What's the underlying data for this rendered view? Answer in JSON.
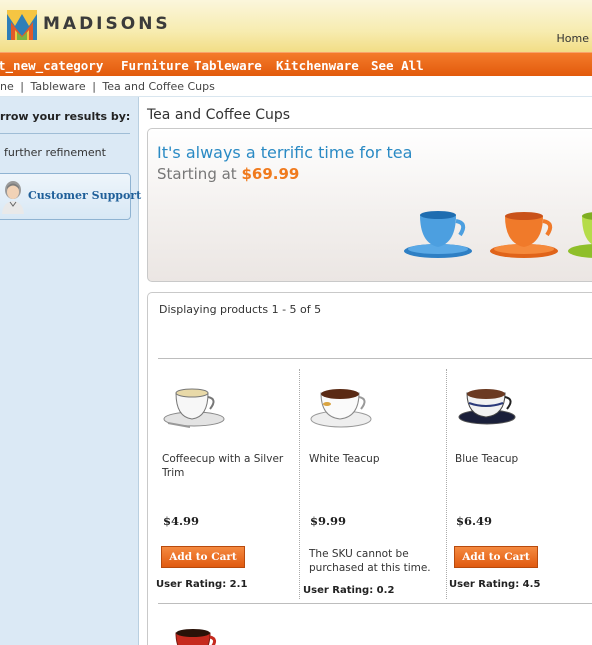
{
  "header": {
    "brand": "MADISONS",
    "home_link": "Home"
  },
  "nav": {
    "items": [
      "t_new_category",
      "Furniture",
      "Tableware",
      "Kitchenware",
      "See All"
    ]
  },
  "breadcrumb": {
    "items": [
      "ne",
      "Tableware",
      "Tea and Coffee Cups"
    ],
    "separator": "|"
  },
  "sidebar": {
    "title": "rrow your results by:",
    "refine_text": "further refinement",
    "support_label": "Customer Support"
  },
  "main": {
    "page_title": "Tea and Coffee Cups",
    "banner": {
      "headline": "It's always a terrific time for tea",
      "sub_prefix": "Starting at ",
      "price": "$69.99"
    },
    "display_count": "Displaying products 1 - 5 of 5",
    "products": [
      {
        "name": "Coffeecup with a Silver Trim",
        "price": "$4.99",
        "action": "Add to Cart",
        "rating": "User Rating: 2.1"
      },
      {
        "name": "White Teacup",
        "price": "$9.99",
        "note": "The SKU cannot be purchased at this time.",
        "rating": "User Rating: 0.2"
      },
      {
        "name": "Blue Teacup",
        "price": "$6.49",
        "action": "Add to Cart",
        "rating": "User Rating: 4.5"
      }
    ]
  },
  "colors": {
    "nav_orange": "#e25a0c",
    "accent_blue": "#2a8ac4",
    "price_orange": "#f07a1d",
    "sidebar_bg": "#dbe9f5"
  }
}
